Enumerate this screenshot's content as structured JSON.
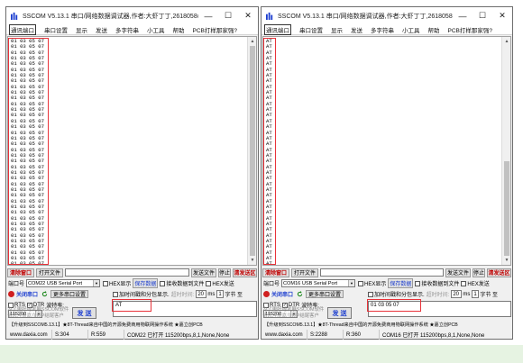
{
  "windows": [
    {
      "id": "left",
      "title": "SSCOM V5.13.1 串口/网络数据调试器,作者:大虾丁丁,2618058@qq...",
      "menu": [
        "通讯端口",
        "串口设置",
        "显示",
        "发送",
        "多字符串",
        "小工具",
        "帮助",
        "PCB打样那家强?"
      ],
      "recv_lines": [
        "01 03 05 07",
        "01 03 05 07",
        "01 03 05 07",
        "01 03 05 07",
        "01 03 05 07",
        "01 03 05 07",
        "01 03 05 07",
        "01 03 05 07",
        "01 03 05 07",
        "01 03 05 07",
        "01 03 05 07",
        "01 03 05 07",
        "01 03 05 07",
        "01 03 05 07",
        "01 03 05 07",
        "01 03 05 07",
        "01 03 05 07",
        "01 03 05 07",
        "01 03 05 07",
        "01 03 05 07",
        "01 03 05 07",
        "01 03 05 07",
        "01 03 05 07",
        "01 03 05 07",
        "01 03 05 07",
        "01 03 05 07",
        "01 03 05 07",
        "01 03 05 07",
        "01 03 05 07",
        "01 03 05 07",
        "01 03 05 07",
        "01 03 05 07",
        "01 03 05 07",
        "01 03 05 07",
        "01 03 05 07",
        "01 03 05 07",
        "01 03 05 07",
        "01 03 05 07",
        "01 03 05 07",
        "01 03 05 07"
      ],
      "scroll_thumb_ratio": 1.0,
      "toolbar": {
        "clear": "清除窗口",
        "open_file": "打开文件",
        "send_file": "发送文件",
        "stop": "停止",
        "clear_send": "清发送区"
      },
      "port_label": "端口号",
      "port_value": "COM22 USB Serial Port",
      "hex_display": "HEX显示",
      "save_data": "保存数据",
      "recv_to_file": "接收数据到文件",
      "hex_send": "HEX发送",
      "close_port": "关闭串口",
      "more_settings": "更多串口设置",
      "timestamp": "加时间戳和分包显示.",
      "timeout_label": "超时时间:",
      "timeout_value": "20",
      "timeout_unit": "ms",
      "byte_value": "1",
      "byte_label": "字节 至",
      "rts": "RTS",
      "dtr": "DTR",
      "baud_label": "波特率:",
      "baud_value": "115200",
      "send_text": "AT",
      "hint1": "为了更好地发展SSCOM软件",
      "hint2": "请您注册嘉立创P结尾客户",
      "send_btn": "发 送",
      "ad_text": "【升级到SSCOM5.13.1】★8T-Thread来自中国的开源免费商用物联网操作系统 ★嘉立创PCB",
      "status": {
        "site": "www.daxia.com",
        "s": "S:304",
        "r": "R:559",
        "port": "COM22 已打开  115200bps,8,1,None,None"
      }
    },
    {
      "id": "right",
      "title": "SSCOM V5.13.1 串口/网络数据调试器,作者:大虾丁丁,2618058@q...",
      "menu": [
        "通讯端口",
        "串口设置",
        "显示",
        "发送",
        "多字符串",
        "小工具",
        "帮助",
        "PCB打样那家强?"
      ],
      "recv_lines": [
        "AT",
        "AT",
        "AT",
        "AT",
        "AT",
        "AT",
        "AT",
        "AT",
        "AT",
        "AT",
        "AT",
        "AT",
        "AT",
        "AT",
        "AT",
        "AT",
        "AT",
        "AT",
        "AT",
        "AT",
        "AT",
        "AT",
        "AT",
        "AT",
        "AT",
        "AT",
        "AT",
        "AT",
        "AT",
        "AT",
        "AT",
        "AT",
        "AT",
        "AT",
        "AT",
        "AT",
        "AT",
        "AT",
        "AT",
        "AT"
      ],
      "scroll_thumb_ratio": 0.45,
      "toolbar": {
        "clear": "清除窗口",
        "open_file": "打开文件",
        "send_file": "发送文件",
        "stop": "停止",
        "clear_send": "清发送区"
      },
      "port_label": "端口号",
      "port_value": "COM16 USB Serial Port",
      "hex_display": "HEX显示",
      "save_data": "保存数据",
      "recv_to_file": "接收数据到文件",
      "hex_send": "HEX发送",
      "close_port": "关闭串口",
      "more_settings": "更多串口设置",
      "timestamp": "加时间戳和分包显示.",
      "timeout_label": "超时时间:",
      "timeout_value": "20",
      "timeout_unit": "ms",
      "byte_value": "1",
      "byte_label": "字节 至",
      "rts": "RTS",
      "dtr": "DTR",
      "baud_label": "波特率:",
      "baud_value": "115200",
      "send_text": "01 03 05 07",
      "hint1": "为了更好地发展SSCOM软件",
      "hint2": "请您注册嘉立创P结尾客户",
      "send_btn": "发 送",
      "ad_text": "【升级到SSCOM5.13.1】★8T-Thread来自中国的开源免费商用物联网操作系统 ★嘉立创PCB",
      "status": {
        "site": "www.daxia.com",
        "s": "S:2288",
        "r": "R:360",
        "port": "COM16 已打开  115200bps,8,1,None,None"
      }
    }
  ],
  "colors": {
    "highlight_box": "#e8333a",
    "title_blue": "#1a3ccf",
    "close_red": "#d02020",
    "footer_green": "#e6f3e2"
  },
  "icons": {
    "app": "sscom-app-icon",
    "minimize": "minimize-icon",
    "maximize": "maximize-icon",
    "close": "close-icon"
  }
}
